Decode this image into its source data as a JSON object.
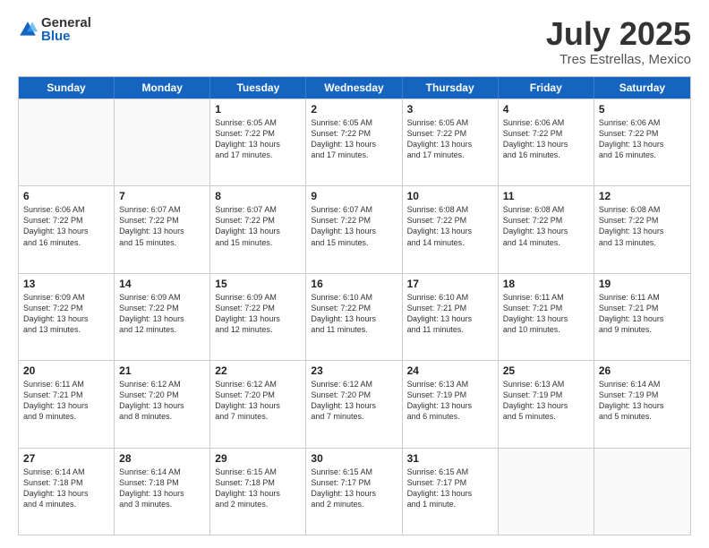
{
  "logo": {
    "general": "General",
    "blue": "Blue"
  },
  "title": "July 2025",
  "location": "Tres Estrellas, Mexico",
  "header_days": [
    "Sunday",
    "Monday",
    "Tuesday",
    "Wednesday",
    "Thursday",
    "Friday",
    "Saturday"
  ],
  "weeks": [
    [
      {
        "day": "",
        "content": ""
      },
      {
        "day": "",
        "content": ""
      },
      {
        "day": "1",
        "content": "Sunrise: 6:05 AM\nSunset: 7:22 PM\nDaylight: 13 hours\nand 17 minutes."
      },
      {
        "day": "2",
        "content": "Sunrise: 6:05 AM\nSunset: 7:22 PM\nDaylight: 13 hours\nand 17 minutes."
      },
      {
        "day": "3",
        "content": "Sunrise: 6:05 AM\nSunset: 7:22 PM\nDaylight: 13 hours\nand 17 minutes."
      },
      {
        "day": "4",
        "content": "Sunrise: 6:06 AM\nSunset: 7:22 PM\nDaylight: 13 hours\nand 16 minutes."
      },
      {
        "day": "5",
        "content": "Sunrise: 6:06 AM\nSunset: 7:22 PM\nDaylight: 13 hours\nand 16 minutes."
      }
    ],
    [
      {
        "day": "6",
        "content": "Sunrise: 6:06 AM\nSunset: 7:22 PM\nDaylight: 13 hours\nand 16 minutes."
      },
      {
        "day": "7",
        "content": "Sunrise: 6:07 AM\nSunset: 7:22 PM\nDaylight: 13 hours\nand 15 minutes."
      },
      {
        "day": "8",
        "content": "Sunrise: 6:07 AM\nSunset: 7:22 PM\nDaylight: 13 hours\nand 15 minutes."
      },
      {
        "day": "9",
        "content": "Sunrise: 6:07 AM\nSunset: 7:22 PM\nDaylight: 13 hours\nand 15 minutes."
      },
      {
        "day": "10",
        "content": "Sunrise: 6:08 AM\nSunset: 7:22 PM\nDaylight: 13 hours\nand 14 minutes."
      },
      {
        "day": "11",
        "content": "Sunrise: 6:08 AM\nSunset: 7:22 PM\nDaylight: 13 hours\nand 14 minutes."
      },
      {
        "day": "12",
        "content": "Sunrise: 6:08 AM\nSunset: 7:22 PM\nDaylight: 13 hours\nand 13 minutes."
      }
    ],
    [
      {
        "day": "13",
        "content": "Sunrise: 6:09 AM\nSunset: 7:22 PM\nDaylight: 13 hours\nand 13 minutes."
      },
      {
        "day": "14",
        "content": "Sunrise: 6:09 AM\nSunset: 7:22 PM\nDaylight: 13 hours\nand 12 minutes."
      },
      {
        "day": "15",
        "content": "Sunrise: 6:09 AM\nSunset: 7:22 PM\nDaylight: 13 hours\nand 12 minutes."
      },
      {
        "day": "16",
        "content": "Sunrise: 6:10 AM\nSunset: 7:22 PM\nDaylight: 13 hours\nand 11 minutes."
      },
      {
        "day": "17",
        "content": "Sunrise: 6:10 AM\nSunset: 7:21 PM\nDaylight: 13 hours\nand 11 minutes."
      },
      {
        "day": "18",
        "content": "Sunrise: 6:11 AM\nSunset: 7:21 PM\nDaylight: 13 hours\nand 10 minutes."
      },
      {
        "day": "19",
        "content": "Sunrise: 6:11 AM\nSunset: 7:21 PM\nDaylight: 13 hours\nand 9 minutes."
      }
    ],
    [
      {
        "day": "20",
        "content": "Sunrise: 6:11 AM\nSunset: 7:21 PM\nDaylight: 13 hours\nand 9 minutes."
      },
      {
        "day": "21",
        "content": "Sunrise: 6:12 AM\nSunset: 7:20 PM\nDaylight: 13 hours\nand 8 minutes."
      },
      {
        "day": "22",
        "content": "Sunrise: 6:12 AM\nSunset: 7:20 PM\nDaylight: 13 hours\nand 7 minutes."
      },
      {
        "day": "23",
        "content": "Sunrise: 6:12 AM\nSunset: 7:20 PM\nDaylight: 13 hours\nand 7 minutes."
      },
      {
        "day": "24",
        "content": "Sunrise: 6:13 AM\nSunset: 7:19 PM\nDaylight: 13 hours\nand 6 minutes."
      },
      {
        "day": "25",
        "content": "Sunrise: 6:13 AM\nSunset: 7:19 PM\nDaylight: 13 hours\nand 5 minutes."
      },
      {
        "day": "26",
        "content": "Sunrise: 6:14 AM\nSunset: 7:19 PM\nDaylight: 13 hours\nand 5 minutes."
      }
    ],
    [
      {
        "day": "27",
        "content": "Sunrise: 6:14 AM\nSunset: 7:18 PM\nDaylight: 13 hours\nand 4 minutes."
      },
      {
        "day": "28",
        "content": "Sunrise: 6:14 AM\nSunset: 7:18 PM\nDaylight: 13 hours\nand 3 minutes."
      },
      {
        "day": "29",
        "content": "Sunrise: 6:15 AM\nSunset: 7:18 PM\nDaylight: 13 hours\nand 2 minutes."
      },
      {
        "day": "30",
        "content": "Sunrise: 6:15 AM\nSunset: 7:17 PM\nDaylight: 13 hours\nand 2 minutes."
      },
      {
        "day": "31",
        "content": "Sunrise: 6:15 AM\nSunset: 7:17 PM\nDaylight: 13 hours\nand 1 minute."
      },
      {
        "day": "",
        "content": ""
      },
      {
        "day": "",
        "content": ""
      }
    ]
  ]
}
